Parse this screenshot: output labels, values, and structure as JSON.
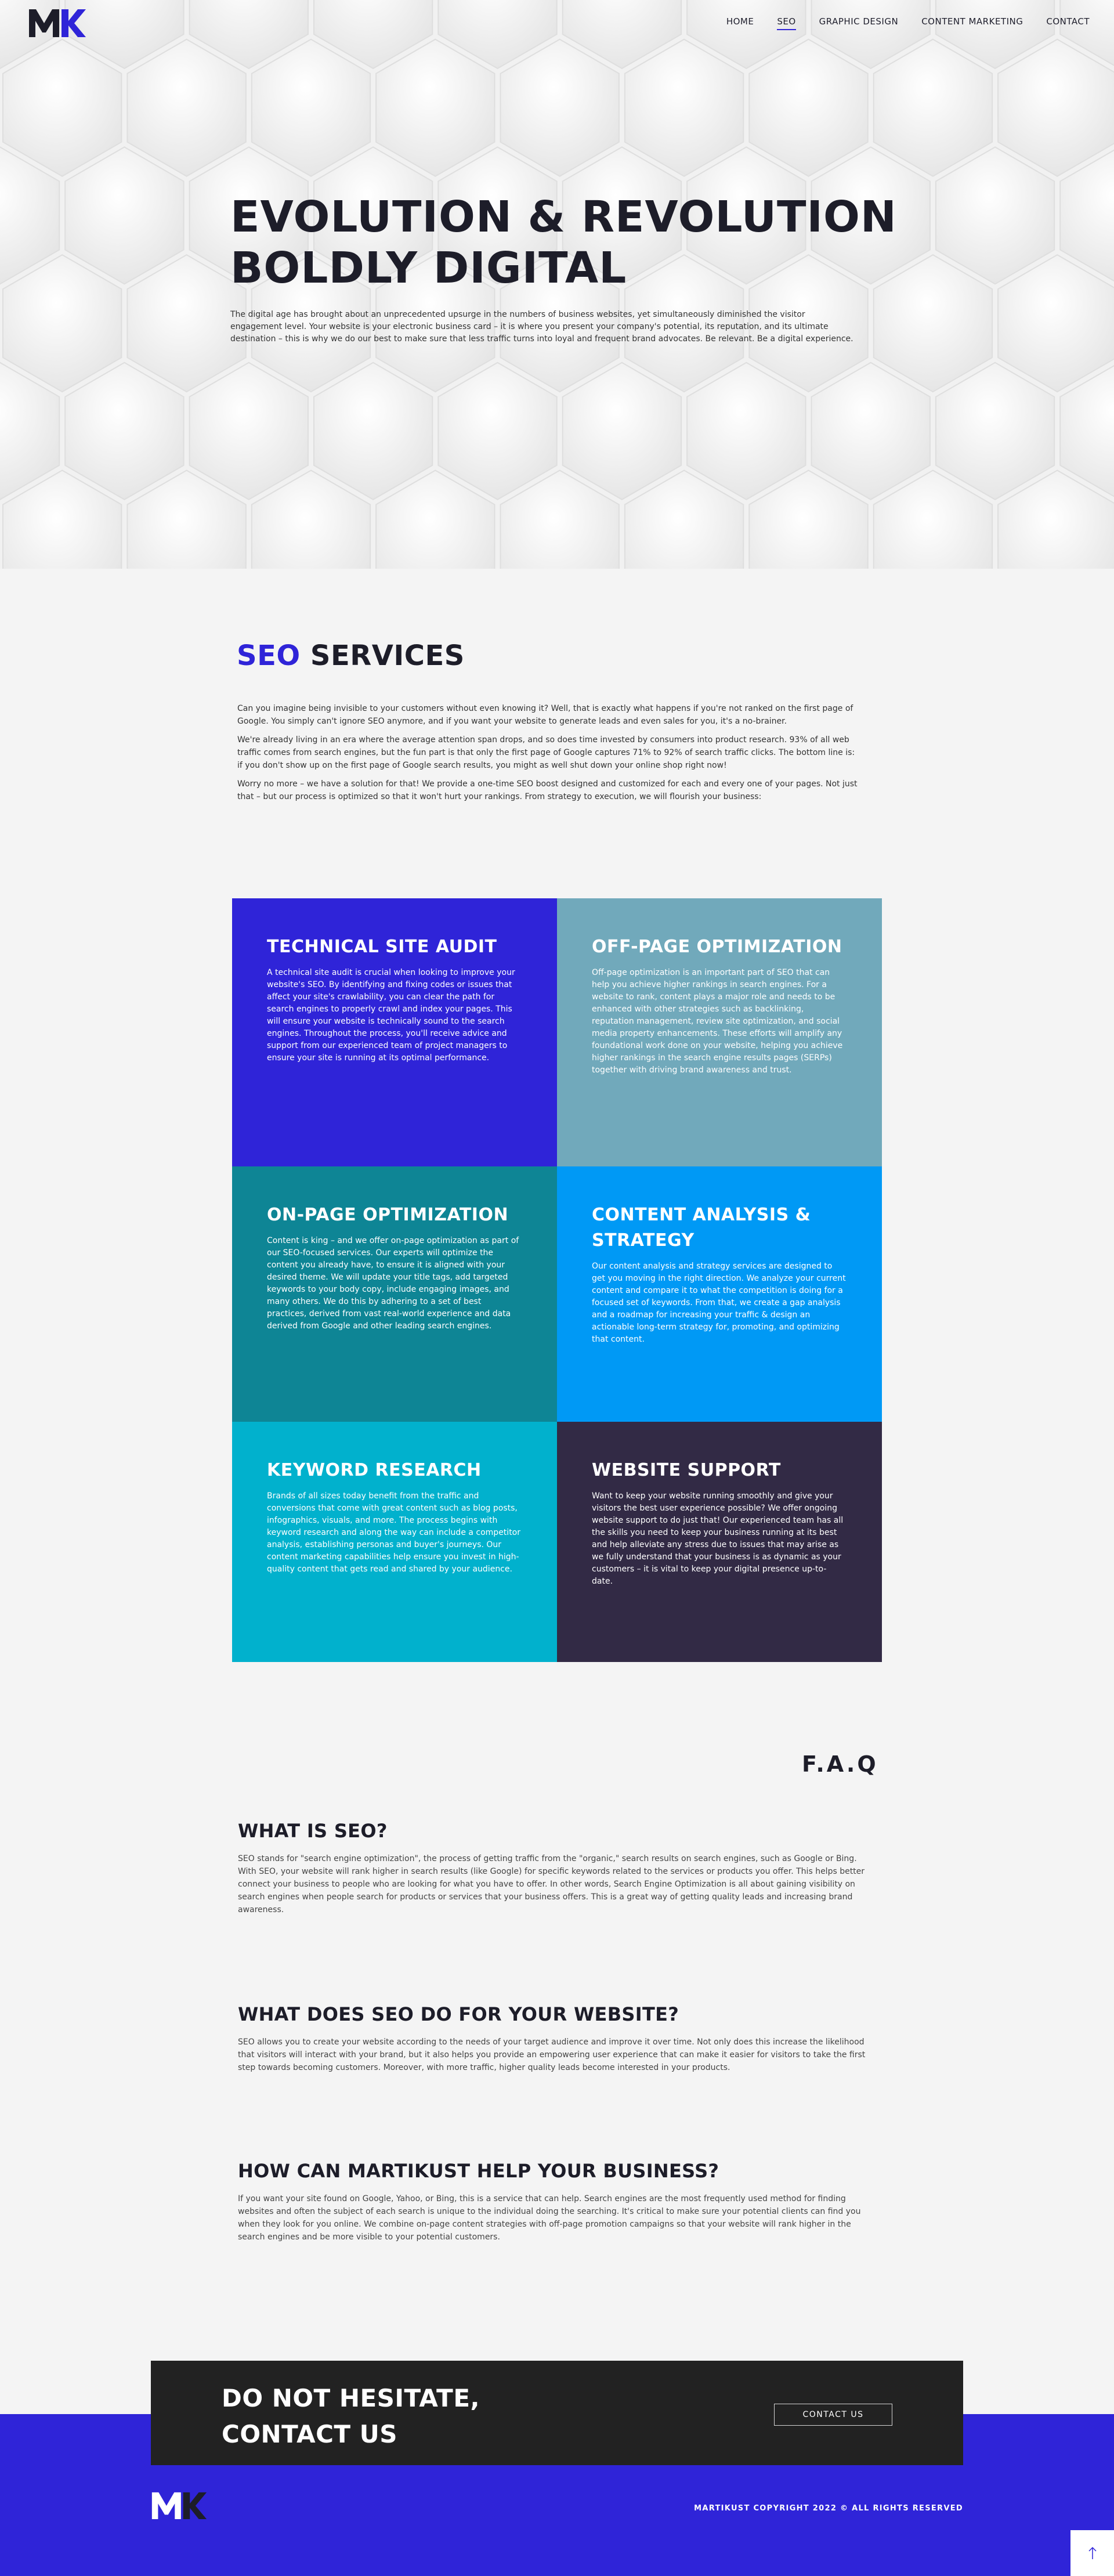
{
  "nav": {
    "logo": "MK",
    "items": [
      {
        "label": "HOME",
        "active": false
      },
      {
        "label": "SEO",
        "active": true
      },
      {
        "label": "GRAPHIC DESIGN",
        "active": false
      },
      {
        "label": "CONTENT MARKETING",
        "active": false
      },
      {
        "label": "CONTACT",
        "active": false
      }
    ]
  },
  "hero": {
    "title_line1": "EVOLUTION & REVOLUTION",
    "title_line2": "BOLDLY DIGITAL",
    "text": "The digital age has brought about an unprecedented upsurge in the numbers of business websites, yet simultaneously diminished the visitor engagement level. Your website is your electronic business card – it is where you present your company's potential, its reputation, and its ultimate destination – this is why we do our best to make sure that less traffic turns into loyal and frequent brand advocates. Be relevant. Be a digital experience."
  },
  "services": {
    "title_accent": "SEO",
    "title_rest": "SERVICES",
    "paragraphs": [
      "Can you imagine being invisible to your customers without even knowing it? Well, that is exactly what happens if you're not ranked on the first page of Google. You simply can't ignore SEO anymore, and if you want your website to generate leads and even sales for you, it's a no-brainer.",
      "We're already living in an era where the average attention span drops, and so does time invested by consumers into product research. 93% of all web traffic comes from search engines, but the fun part is that only the first page of Google captures 71% to 92% of search traffic clicks. The bottom line is: if you don't show up on the first page of Google search results, you might as well shut down your online shop right now!",
      "Worry no more – we have a solution for that! We provide a one-time SEO boost designed and customized for each and every one of your pages. Not just that – but our process is optimized so that it won't hurt your rankings. From strategy to execution, we will flourish your business:"
    ],
    "cards": [
      {
        "title": "TECHNICAL SITE AUDIT",
        "color": "#2f24d8",
        "text": "A technical site audit is crucial when looking to improve your website's SEO. By identifying and fixing codes or issues that affect your site's crawlability, you can clear the path for search engines to properly crawl and index your pages. This will ensure your website is technically sound to the search engines. Throughout the process, you'll receive advice and support from our experienced team of project managers to ensure your site is running at its optimal performance."
      },
      {
        "title": "OFF-PAGE OPTIMIZATION",
        "color": "#71a9bb",
        "text": "Off-page optimization is an important part of SEO that can help you achieve higher rankings in search engines. For a website to rank, content plays a major role and needs to be enhanced with other strategies such as backlinking, reputation management, review site optimization, and social media property enhancements. These efforts will amplify any foundational work done on your website, helping you achieve higher rankings in the search engine results pages (SERPs) together with driving brand awareness and trust."
      },
      {
        "title": "ON-PAGE OPTIMIZATION",
        "color": "#0e8595",
        "text": "Content is king – and we offer on-page optimization as part of our SEO-focused services. Our experts will optimize the content you already have, to ensure it is aligned with your desired theme. We will update your title tags, add targeted keywords to your body copy, include engaging images, and many others. We do this by adhering to a set of best practices, derived from vast real-world experience and data derived from Google and other leading search engines."
      },
      {
        "title": "CONTENT ANALYSIS & STRATEGY",
        "color": "#0099f5",
        "text": "Our content analysis and strategy services are designed to get you moving in the right direction. We analyze your current content and compare it to what the competition is doing for a focused set of keywords. From that, we create a gap analysis and a roadmap for increasing your traffic & design an actionable long-term strategy for, promoting, and optimizing that content."
      },
      {
        "title": "KEYWORD RESEARCH",
        "color": "#01b1cd",
        "text": "Brands of all sizes today benefit from the traffic and conversions that come with great content such as blog posts, infographics, visuals, and more. The process begins with keyword research and along the way can include a competitor analysis, establishing personas and buyer's journeys. Our content marketing capabilities help ensure you invest in high-quality content that gets read and shared by your audience."
      },
      {
        "title": "WEBSITE SUPPORT",
        "color": "#322a45",
        "text": "Want to keep your website running smoothly and give your visitors the best user experience possible? We offer ongoing website support to do just that! Our experienced team has all the skills you need to keep your business running at its best and help alleviate any stress due to issues that may arise as we fully understand that your business is as dynamic as your customers – it is vital to keep your digital presence up-to-date."
      }
    ]
  },
  "faq": {
    "heading": "F.A.Q",
    "items": [
      {
        "question": "WHAT IS SEO?",
        "answer": "SEO stands for \"search engine optimization\", the process of getting traffic from the \"organic,\" search results on search engines, such as Google or Bing. With SEO, your website will rank higher in search results (like Google) for specific keywords related to the services or products you offer. This helps better connect your business to people who are looking for what you have to offer. In other words, Search Engine Optimization is all about gaining visibility on search engines when people search for products or services that your business offers. This is a great way of getting quality leads and increasing brand awareness."
      },
      {
        "question": "WHAT DOES SEO DO FOR YOUR WEBSITE?",
        "answer": "SEO allows you to create your website according to the needs of your target audience and improve it over time. Not only does this increase the likelihood that visitors will interact with your brand, but it also helps you provide an empowering user experience that can make it easier for visitors to take the first step towards becoming customers. Moreover, with more traffic, higher quality leads become interested in your products."
      },
      {
        "question": "HOW CAN MARTIKUST HELP YOUR BUSINESS?",
        "answer": "If you want your site found on Google, Yahoo, or Bing, this is a service that can help. Search engines are the most frequently used method for finding websites and often the subject of each search is unique to the individual doing the searching. It's critical to make sure your potential clients can find you when they look for you online. We combine on-page content strategies with off-page promotion campaigns so that your website will rank higher in the search engines and be more visible to your potential customers."
      }
    ]
  },
  "cta": {
    "line1": "DO NOT HESITATE,",
    "line2": "CONTACT US",
    "button": "CONTACT US"
  },
  "footer": {
    "logo": "MK",
    "copyright": "MARTIKUST COPYRIGHT 2022 © ALL RIGHTS RESERVED",
    "scroll_top_icon": "arrow-up-icon"
  },
  "colors": {
    "brand_blue": "#2f24d8",
    "dark": "#1d1d29",
    "cta_bg": "#222222"
  }
}
